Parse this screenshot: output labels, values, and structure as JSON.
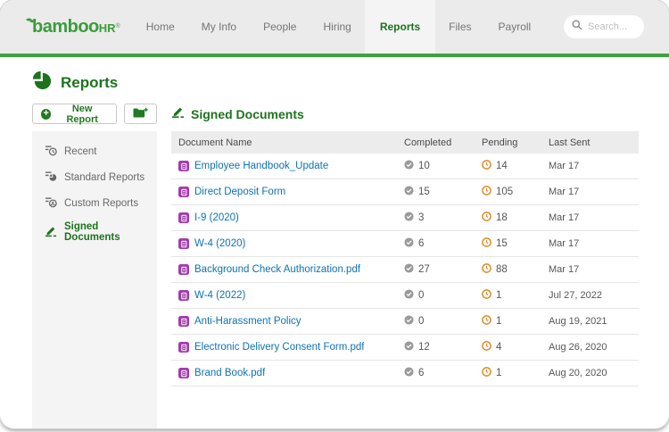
{
  "brand": {
    "name_lower": "bamboo",
    "name_upper": "HR",
    "registered": "®"
  },
  "nav": {
    "items": [
      {
        "label": "Home",
        "active": false
      },
      {
        "label": "My Info",
        "active": false
      },
      {
        "label": "People",
        "active": false
      },
      {
        "label": "Hiring",
        "active": false
      },
      {
        "label": "Reports",
        "active": true
      },
      {
        "label": "Files",
        "active": false
      },
      {
        "label": "Payroll",
        "active": false
      }
    ],
    "search_placeholder": "Search..."
  },
  "page": {
    "title": "Reports"
  },
  "toolbar": {
    "new_report_label": "New Report"
  },
  "sidebar": {
    "items": [
      {
        "label": "Recent",
        "active": false
      },
      {
        "label": "Standard Reports",
        "active": false
      },
      {
        "label": "Custom Reports",
        "active": false
      },
      {
        "label": "Signed Documents",
        "active": true
      }
    ]
  },
  "section": {
    "title": "Signed Documents"
  },
  "table": {
    "columns": [
      "Document Name",
      "Completed",
      "Pending",
      "Last Sent"
    ],
    "rows": [
      {
        "name": "Employee Handbook_Update",
        "completed": "10",
        "pending": "14",
        "last_sent": "Mar 17"
      },
      {
        "name": "Direct Deposit Form",
        "completed": "15",
        "pending": "105",
        "last_sent": "Mar 17"
      },
      {
        "name": "I-9 (2020)",
        "completed": "3",
        "pending": "18",
        "last_sent": "Mar 17"
      },
      {
        "name": "W-4 (2020)",
        "completed": "6",
        "pending": "15",
        "last_sent": "Mar 17"
      },
      {
        "name": "Background Check Authorization.pdf",
        "completed": "27",
        "pending": "88",
        "last_sent": "Mar 17"
      },
      {
        "name": "W-4 (2022)",
        "completed": "0",
        "pending": "1",
        "last_sent": "Jul 27, 2022"
      },
      {
        "name": "Anti-Harassment Policy",
        "completed": "0",
        "pending": "1",
        "last_sent": "Aug 19, 2021"
      },
      {
        "name": "Electronic Delivery Consent Form.pdf",
        "completed": "12",
        "pending": "4",
        "last_sent": "Aug 26, 2020"
      },
      {
        "name": "Brand Book.pdf",
        "completed": "6",
        "pending": "1",
        "last_sent": "Aug 20, 2020"
      }
    ]
  },
  "colors": {
    "brand_green": "#3fa23c",
    "heading_green": "#1d731d",
    "link_blue": "#0e72b5",
    "document_purple": "#a23bac",
    "pending_orange": "#dd8a27",
    "completed_gray": "#9a9a9a"
  }
}
